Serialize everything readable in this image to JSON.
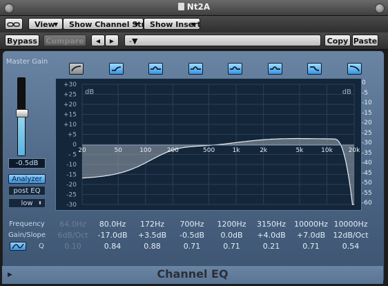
{
  "window": {
    "title": "Nt2A"
  },
  "toolbar1": {
    "view_label": "View",
    "channel_strip_label": "Show Channel Strip",
    "insert_label": "Show Insert"
  },
  "toolbar2": {
    "bypass_label": "Bypass",
    "compare_label": "Compare",
    "prev_label": "◀",
    "next_label": "▶",
    "preset_value": "-",
    "copy_label": "Copy",
    "paste_label": "Paste"
  },
  "plugin": {
    "master_gain_label": "Master Gain",
    "master_gain_value": "-0.5dB",
    "master_gain_level": 0.55,
    "analyzer_label": "Analyzer",
    "analyzer_mode": "post EQ",
    "resolution": "low",
    "frequency_label": "Frequency",
    "gain_slope_label": "Gain/Slope",
    "q_label": "Q",
    "name": "Channel EQ",
    "graph": {
      "db_label_left": "dB",
      "db_label_right": "dB",
      "left_ticks": [
        "+30",
        "+25",
        "+20",
        "+15",
        "+10",
        "+5",
        "0",
        "- 5",
        "-10",
        "-15",
        "-20",
        "-25",
        "-30"
      ],
      "right_ticks": [
        "0",
        "-5",
        "-10",
        "-15",
        "-20",
        "-25",
        "-30",
        "-35",
        "-40",
        "-45",
        "-50",
        "-55",
        "-60"
      ],
      "freq_ticks": [
        "20",
        "50",
        "100",
        "200",
        "500",
        "1k",
        "2k",
        "5k",
        "10k",
        "20k"
      ]
    },
    "bands": [
      {
        "active": false,
        "freq": "64.0Hz",
        "gain": "6dB/Oct",
        "q": "0.10",
        "shape": "lowcut"
      },
      {
        "active": true,
        "freq": "80.0Hz",
        "gain": "-17.0dB",
        "q": "0.84",
        "shape": "lowshelf"
      },
      {
        "active": true,
        "freq": "172Hz",
        "gain": "+3.5dB",
        "q": "0.88",
        "shape": "bell"
      },
      {
        "active": true,
        "freq": "700Hz",
        "gain": "-0.5dB",
        "q": "0.71",
        "shape": "bell"
      },
      {
        "active": true,
        "freq": "1200Hz",
        "gain": "0.0dB",
        "q": "0.71",
        "shape": "bell"
      },
      {
        "active": true,
        "freq": "3150Hz",
        "gain": "+4.0dB",
        "q": "0.21",
        "shape": "bell"
      },
      {
        "active": true,
        "freq": "10000Hz",
        "gain": "+7.0dB",
        "q": "0.71",
        "shape": "highshelf"
      },
      {
        "active": true,
        "freq": "10000Hz",
        "gain": "12dB/Oct",
        "q": "0.54",
        "shape": "highcut"
      }
    ]
  },
  "colors": {
    "accent": "#5ab4e0",
    "panel": "#4a6382",
    "graph_bg": "#14263a",
    "curve_fill": "#9aa4ae"
  }
}
